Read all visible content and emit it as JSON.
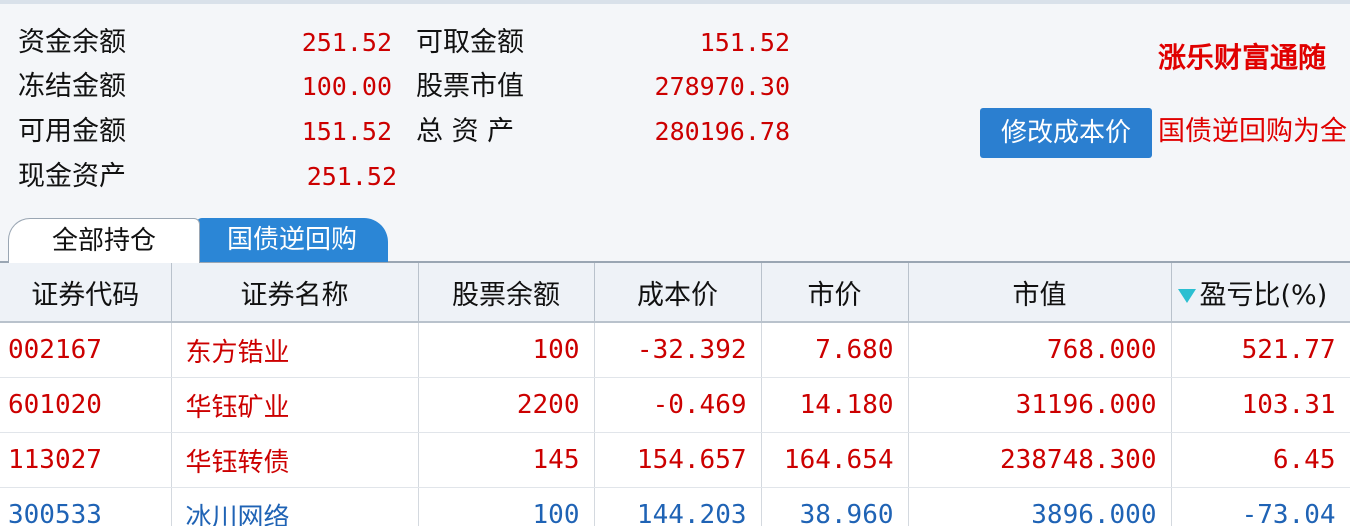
{
  "summary": {
    "fund_balance_label": "资金余额",
    "fund_balance_value": "251.52",
    "withdrawable_label": "可取金额",
    "withdrawable_value": "151.52",
    "frozen_label": "冻结金额",
    "frozen_value": "100.00",
    "stock_value_label": "股票市值",
    "stock_value_value": "278970.30",
    "available_label": "可用金额",
    "available_value": "151.52",
    "total_assets_label": "总 资 产",
    "total_assets_value": "280196.78",
    "cash_assets_label": "现金资产",
    "cash_assets_value": "251.52"
  },
  "brand_text": "涨乐财富通随",
  "modify_cost_button": "修改成本价",
  "promo_text": "国债逆回购为全",
  "tabs": [
    {
      "label": "全部持仓",
      "active": true
    },
    {
      "label": "国债逆回购",
      "active": false
    }
  ],
  "table": {
    "headers": [
      "证券代码",
      "证券名称",
      "股票余额",
      "成本价",
      "市价",
      "市值",
      "盈亏比(%)"
    ],
    "sort_column": 6,
    "rows": [
      {
        "code": "002167",
        "name": "东方锆业",
        "qty": "100",
        "cost": "-32.392",
        "price": "7.680",
        "mkt_value": "768.000",
        "pl_ratio": "521.77",
        "color": "red"
      },
      {
        "code": "601020",
        "name": "华钰矿业",
        "qty": "2200",
        "cost": "-0.469",
        "price": "14.180",
        "mkt_value": "31196.000",
        "pl_ratio": "103.31",
        "color": "red"
      },
      {
        "code": "113027",
        "name": "华钰转债",
        "qty": "145",
        "cost": "154.657",
        "price": "164.654",
        "mkt_value": "238748.300",
        "pl_ratio": "6.45",
        "color": "red"
      },
      {
        "code": "300533",
        "name": "冰川网络",
        "qty": "100",
        "cost": "144.203",
        "price": "38.960",
        "mkt_value": "3896.000",
        "pl_ratio": "-73.04",
        "color": "blue"
      }
    ]
  },
  "colors": {
    "positive": "#cc0000",
    "negative": "#1f63b5",
    "accent": "#2b86d6"
  }
}
